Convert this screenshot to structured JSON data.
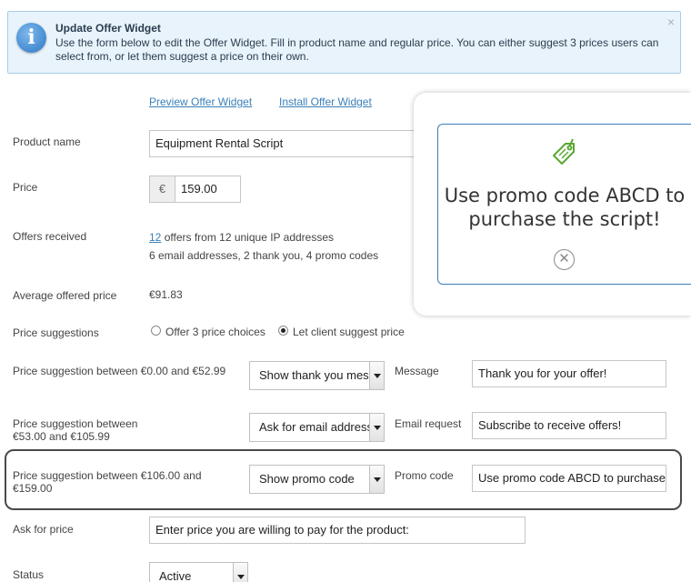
{
  "notice": {
    "icon": "info-icon",
    "icon_glyph": "i",
    "title": "Update Offer Widget",
    "text": "Use the form below to edit the Offer Widget. Fill in product name and regular price. You can either suggest 3 prices users can select from, or let them suggest a price on their own.",
    "close_glyph": "×"
  },
  "links": {
    "preview": "Preview Offer Widget",
    "install": "Install Offer Widget"
  },
  "form": {
    "product_name": {
      "label": "Product name",
      "value": "Equipment Rental Script"
    },
    "price": {
      "label": "Price",
      "currency": "€",
      "value": "159.00"
    },
    "offers": {
      "label": "Offers received",
      "count_link": "12",
      "line1_rest": " offers from 12 unique IP addresses",
      "line2": "6 email addresses, 2 thank you, 4 promo codes"
    },
    "average": {
      "label": "Average offered price",
      "value": "€91.83"
    },
    "suggestions": {
      "label": "Price suggestions",
      "options": [
        "Offer 3 price choices",
        "Let client suggest price"
      ],
      "selected": "Let client suggest price"
    },
    "ranges": [
      {
        "label": "Price suggestion between €0.00 and €52.99",
        "select": "Show thank you message",
        "field_label": "Message",
        "field_value": "Thank you for your offer!"
      },
      {
        "label": "Price suggestion between €53.00 and €105.99",
        "select": "Ask for email address",
        "field_label": "Email request",
        "field_value": "Subscribe to receive offers!"
      },
      {
        "label": "Price suggestion between €106.00 and €159.00",
        "select": "Show promo code",
        "field_label": "Promo code",
        "field_value": "Use promo code ABCD to purchase the script!"
      }
    ],
    "ask_price": {
      "label": "Ask for price",
      "value": "Enter price you are willing to pay for the product:"
    },
    "status": {
      "label": "Status",
      "value": "Active"
    }
  },
  "popup": {
    "icon": "price-tag-icon",
    "message": "Use promo code ABCD to purchase the script!",
    "close_glyph": "✕",
    "accent": "#3a7fb9",
    "tag_color": "#5aa832"
  }
}
